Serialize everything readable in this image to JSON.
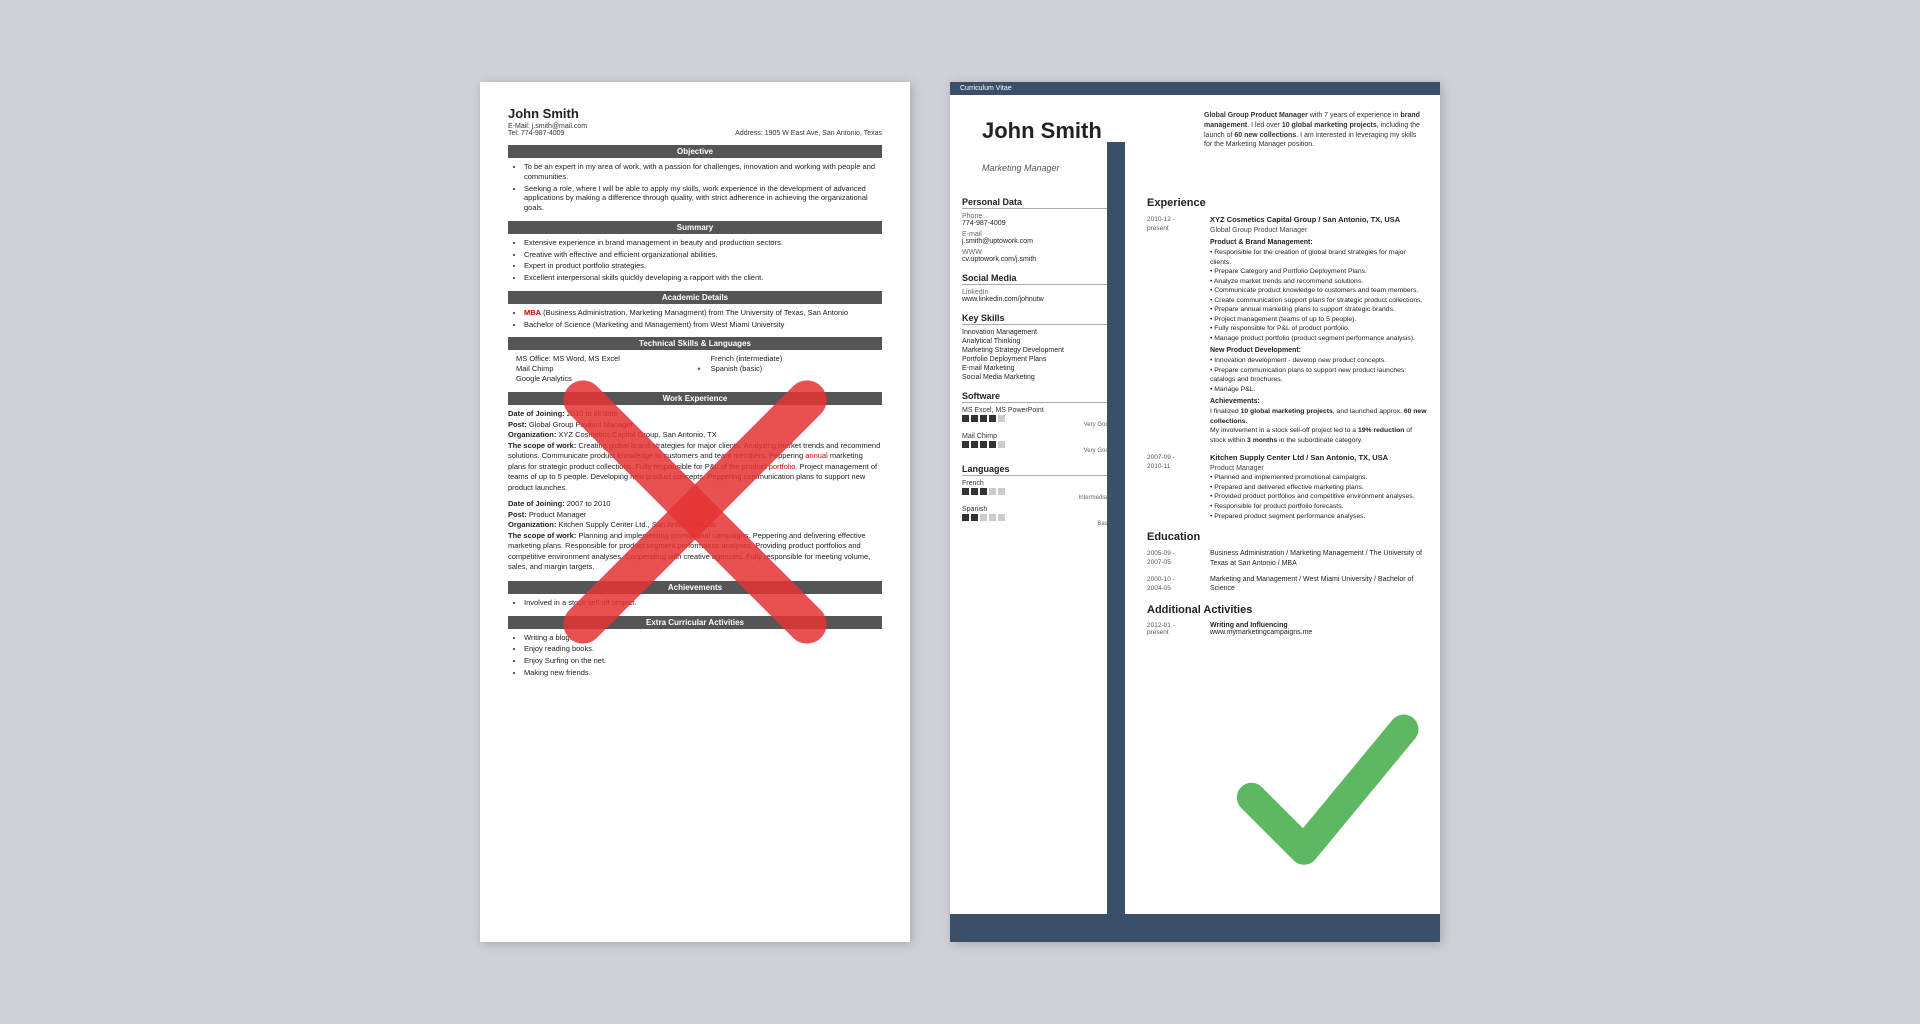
{
  "left_resume": {
    "name": "John Smith",
    "email": "E-Mail: j.smith@mail.com",
    "tel": "Tel: 774-987-4009",
    "address": "Address: 1905 W East Ave, San Antonio, Texas",
    "sections": {
      "objective": {
        "header": "Objective",
        "bullets": [
          "To be an expert in my area of work, with a passion for challenges, innovation and working with people and communities.",
          "Seeking a role, where I will be able to apply my skills, work experience in the development of advanced applications by making a difference through quality, with strict adherence in achieving the organizational goals."
        ]
      },
      "summary": {
        "header": "Summary",
        "bullets": [
          "Extensive experience in brand management in beauty and production sectors.",
          "Creative with effective and efficient organizational abilities.",
          "Expert in product portfolio strategies.",
          "Excellent interpersonal skills quickly developing a rapport with the client."
        ]
      },
      "academic": {
        "header": "Academic Details",
        "bullets": [
          "MBA (Business Administration, Marketing Managment) from The University of Texas, San Antonio",
          "Bachelor of Science (Marketing and Management) from West Miami University"
        ]
      },
      "technical": {
        "header": "Technical Skills & Languages",
        "skills_left": [
          "MS Office: MS Word, MS Excel",
          "Mail Chimp",
          "Google Analytics"
        ],
        "skills_right": [
          "French (intermediate)",
          "Spanish (basic)"
        ]
      },
      "work": {
        "header": "Work Experience",
        "jobs": [
          {
            "joining": "Date of Joining: 2010 to till date",
            "post": "Post: Global Group Product Manager",
            "org": "Organization: XYZ Cosmetics Capital Group, San Antonio, TX",
            "scope": "The scope of work: Creating global brand strategies for major clients. Analyzing market trends and recommend solutions. Communicate product knowledge to customers and team members. Peppering annual marketing plans for strategic product collections. Fully responsible for P&L of the product portfolio. Project management of teams of up to 5 people. Developing new product concepts. Peppering communication plans to support new product launches."
          },
          {
            "joining": "Date of Joining: 2007 to 2010",
            "post": "Post: Product Manager",
            "org": "Organization: Kitchen Supply Center Ltd., San Antonio, Texas",
            "scope": "The scope of work: Planning and implementing promotional campaigns. Peppering and delivering effective marketing plans. Responsible for product segment performance analyses. Providing product portfolios and competitive environment analyses. Cooperating with creative agencies. Fully responsible for meeting volume, sales, and margin targets."
          }
        ]
      },
      "achievements": {
        "header": "Achievements",
        "bullets": [
          "Involved in a stock sell-off project."
        ]
      },
      "extra": {
        "header": "Extra Curricular Activities",
        "bullets": [
          "Writing a blog.",
          "Enjoy reading books.",
          "Enjoy Surfing on the net.",
          "Making new friends."
        ]
      }
    }
  },
  "right_resume": {
    "cv_tag": "Curriculum Vitae",
    "name": "John Smith",
    "title": "Marketing Manager",
    "personal_data": {
      "section": "Personal Data",
      "phone_label": "Phone",
      "phone": "774-987-4009",
      "email_label": "E-mail",
      "email": "j.smith@uptowork.com",
      "www_label": "WWW",
      "www": "cv.uptowork.com/j.smith"
    },
    "social_media": {
      "section": "Social Media",
      "linkedin_label": "LinkedIn",
      "linkedin": "www.linkedin.com/johnutw"
    },
    "key_skills": {
      "section": "Key Skills",
      "items": [
        "Innovation Management",
        "Analytical Thinking",
        "Marketing Strategy Development",
        "Portfolio Deployment Plans",
        "E-mail Marketing",
        "Social Media Marketing"
      ]
    },
    "software": {
      "section": "Software",
      "items": [
        {
          "name": "MS Excel, MS PowerPoint",
          "dots": 4,
          "total": 5,
          "level": "Very Good"
        },
        {
          "name": "Mail Chimp",
          "dots": 4,
          "total": 5,
          "level": "Very Good"
        }
      ]
    },
    "languages": {
      "section": "Languages",
      "items": [
        {
          "name": "French",
          "dots": 3,
          "total": 5,
          "level": "Intermediate"
        },
        {
          "name": "Spanish",
          "dots": 2,
          "total": 5,
          "level": "Basic"
        }
      ]
    },
    "summary_text": "Global Group Product Manager with 7 years of experience in brand management. I led over 10 global marketing projects, including the launch of 60 new collections. I am interested in leveraging my skills for the Marketing Manager position.",
    "experience": {
      "section": "Experience",
      "jobs": [
        {
          "date": "2010-12 - present",
          "company": "XYZ Cosmetics Capital Group / San Antonio, TX, USA",
          "role": "Global Group Product Manager",
          "subsections": [
            {
              "title": "Product & Brand Management:",
              "bullets": [
                "Responsible for the creation of global brand strategies for major clients.",
                "Prepare Category and Portfolio Deployment Plans.",
                "Analyze market trends and recommend solutions.",
                "Communicate product knowledge to customers and team members.",
                "Create communication support plans for strategic product collections.",
                "Prepare annual marketing plans to support strategic brands.",
                "Project management (teams of up to 5 people).",
                "Fully responsible for P&L of product portfolio.",
                "Manage product portfolio (product segment performance analysis)."
              ]
            },
            {
              "title": "New Product Development:",
              "bullets": [
                "Innovation development - develop new product concepts.",
                "Prepare communication plans to support new product launches: catalogs and brochures.",
                "Manage P&L."
              ]
            },
            {
              "title": "Achievements:",
              "text": "I finalized 10 global marketing projects, and launched approx. 60 new collections. My involvement in a stock sell-off project led to a 19% reduction of stock within 3 months in the subordinate category."
            }
          ]
        },
        {
          "date": "2007-09 - 2010-11",
          "company": "Kitchen Supply Center Ltd / San Antonio, TX, USA",
          "role": "Product Manager",
          "bullets": [
            "Planned and implemented promotional campaigns.",
            "Prepared and delivered effective marketing plans.",
            "Provided product portfolios and competitive environment analyses.",
            "Responsible for product portfolio forecasts.",
            "Prepared product segment performance analyses."
          ]
        }
      ]
    },
    "education": {
      "section": "Education",
      "items": [
        {
          "date": "2005-09 - 2007-05",
          "text": "Business Administration / Marketing Management / The University of Texas at San Antonio / MBA"
        },
        {
          "date": "2000-10 - 2004-05",
          "text": "Marketing and Management / West Miami University / Bachelor of Science"
        }
      ]
    },
    "additional": {
      "section": "Additional Activities",
      "items": [
        {
          "date": "2012-01 - present",
          "title": "Writing and Influencing",
          "text": "www.mymarketingcampaigns.me"
        }
      ]
    }
  }
}
